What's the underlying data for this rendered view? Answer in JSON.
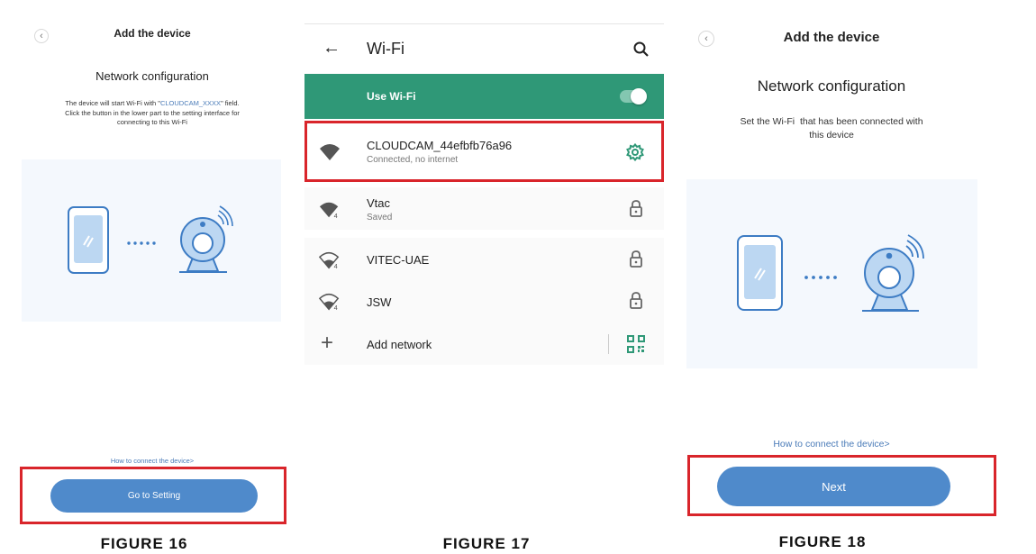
{
  "figure16": {
    "header_title": "Add the device",
    "subtitle": "Network configuration",
    "desc_line1_pre": "The device will start Wi-Fi with \"",
    "desc_line1_ssid": "CLOUDCAM_XXXX",
    "desc_line1_post": "\" field.",
    "desc_line2": "Click the button in the lower part to the setting interface for",
    "desc_line3": "connecting to this Wi-Fi",
    "help_link": "How to connect the device>",
    "button_label": "Go to Setting",
    "caption": "FIGURE 16"
  },
  "figure17": {
    "title": "Wi-Fi",
    "use_wifi_label": "Use Wi-Fi",
    "use_wifi_on": true,
    "networks": [
      {
        "name": "CLOUDCAM_44efbfb76a96",
        "status": "Connected, no internet",
        "icon": "wifi-full-icon",
        "action_icon": "gear-icon"
      },
      {
        "name": "Vtac",
        "status": "Saved",
        "icon": "wifi-4-icon",
        "action_icon": "lock-icon"
      },
      {
        "name": "VITEC-UAE",
        "status": "",
        "icon": "wifi-4-weak-icon",
        "action_icon": "lock-icon"
      },
      {
        "name": "JSW",
        "status": "",
        "icon": "wifi-4-weak-icon",
        "action_icon": "lock-icon"
      }
    ],
    "add_network_label": "Add network",
    "caption": "FIGURE 17"
  },
  "figure18": {
    "header_title": "Add the device",
    "subtitle": "Network configuration",
    "desc_line1": "Set the Wi-Fi  that has been connected with",
    "desc_line2": "this device",
    "help_link": "How to connect the device>",
    "button_label": "Next",
    "caption": "FIGURE 18"
  },
  "colors": {
    "accent_blue": "#4f8acb",
    "link_blue": "#4a7bb8",
    "android_green": "#2f9877",
    "highlight_red": "#d9252b"
  }
}
